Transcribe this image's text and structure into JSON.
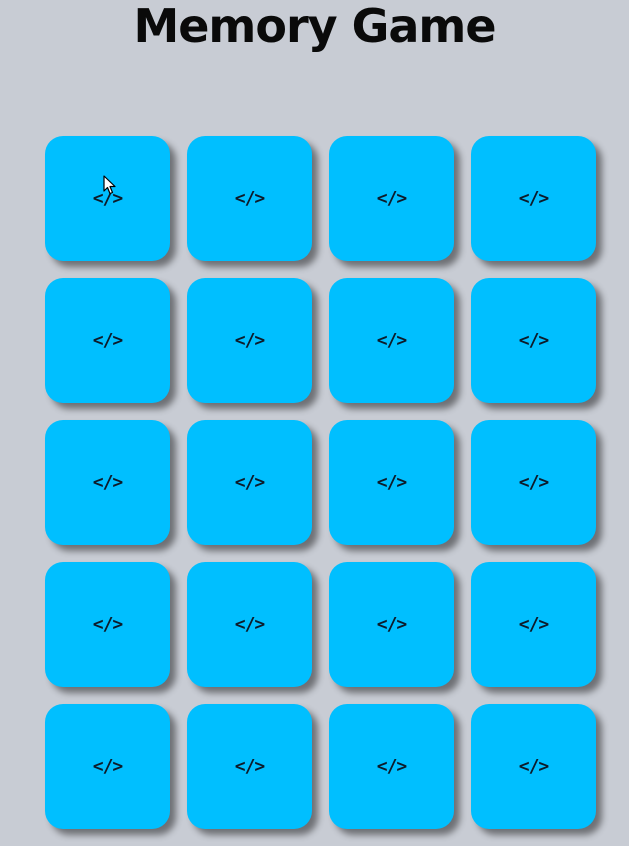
{
  "header": {
    "title": "Memory Game"
  },
  "board": {
    "rows": 5,
    "columns": 4,
    "card_face_down_glyph": "</>",
    "card_icon_name": "code-icon",
    "card_color": "#00bfff",
    "background_color": "#c8ccd4",
    "cards": [
      {
        "state": "face-down"
      },
      {
        "state": "face-down"
      },
      {
        "state": "face-down"
      },
      {
        "state": "face-down"
      },
      {
        "state": "face-down"
      },
      {
        "state": "face-down"
      },
      {
        "state": "face-down"
      },
      {
        "state": "face-down"
      },
      {
        "state": "face-down"
      },
      {
        "state": "face-down"
      },
      {
        "state": "face-down"
      },
      {
        "state": "face-down"
      },
      {
        "state": "face-down"
      },
      {
        "state": "face-down"
      },
      {
        "state": "face-down"
      },
      {
        "state": "face-down"
      },
      {
        "state": "face-down"
      },
      {
        "state": "face-down"
      },
      {
        "state": "face-down"
      },
      {
        "state": "face-down"
      }
    ]
  }
}
